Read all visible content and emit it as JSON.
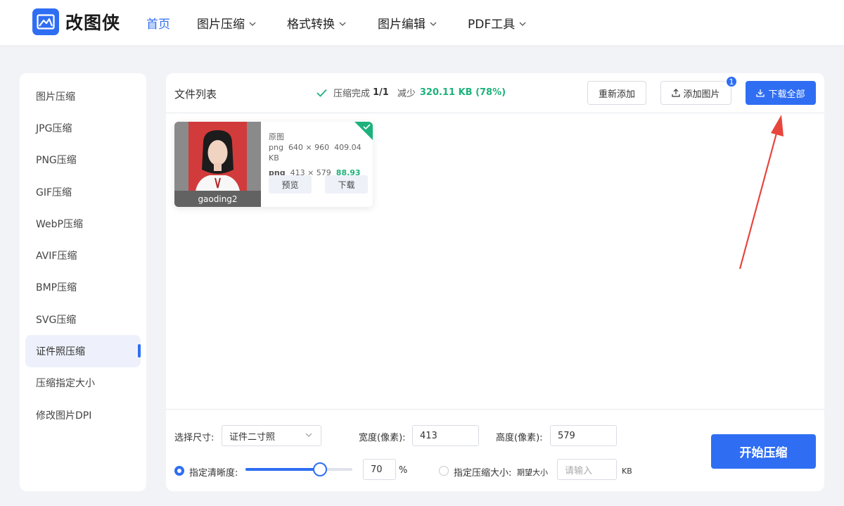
{
  "header": {
    "logo_text": "改图侠",
    "nav": [
      {
        "label": "首页",
        "active": true
      },
      {
        "label": "图片压缩",
        "dropdown": true
      },
      {
        "label": "格式转换",
        "dropdown": true
      },
      {
        "label": "图片编辑",
        "dropdown": true
      },
      {
        "label": "PDF工具",
        "dropdown": true
      }
    ]
  },
  "sidebar": {
    "items": [
      {
        "label": "图片压缩"
      },
      {
        "label": "JPG压缩"
      },
      {
        "label": "PNG压缩"
      },
      {
        "label": "GIF压缩"
      },
      {
        "label": "WebP压缩"
      },
      {
        "label": "AVIF压缩"
      },
      {
        "label": "BMP压缩"
      },
      {
        "label": "SVG压缩"
      },
      {
        "label": "证件照压缩",
        "active": true
      },
      {
        "label": "压缩指定大小"
      },
      {
        "label": "修改图片DPI"
      }
    ]
  },
  "toolbar": {
    "title": "文件列表",
    "status_label": "压缩完成",
    "status_count": "1/1",
    "reduce_label": "减少",
    "reduce_value": "320.11 KB (78%)",
    "readd_label": "重新添加",
    "add_image_label": "添加图片",
    "add_image_badge": "1",
    "download_all_label": "下载全部"
  },
  "file_card": {
    "name": "gaoding2",
    "original_label": "原图",
    "original_format": "png",
    "original_dims": "640 × 960",
    "original_size": "409.04 KB",
    "compressed_format": "png",
    "compressed_dims": "413 × 579",
    "compressed_size": "88.93 KB",
    "preview_label": "预览",
    "download_label": "下载"
  },
  "settings": {
    "size_label": "选择尺寸:",
    "size_value": "证件二寸照",
    "width_label": "宽度(像素):",
    "width_value": "413",
    "height_label": "高度(像素):",
    "height_value": "579",
    "clarity_label": "指定清晰度:",
    "clarity_value": "70",
    "clarity_unit": "%",
    "clarity_fraction": 0.7,
    "target_size_label": "指定压缩大小:",
    "expected_label": "期望大小",
    "expected_placeholder": "请输入",
    "expected_unit": "KB",
    "start_label": "开始压缩"
  },
  "colors": {
    "accent": "#2f6ef3",
    "success": "#1db27b",
    "arrow": "#e8453c"
  }
}
